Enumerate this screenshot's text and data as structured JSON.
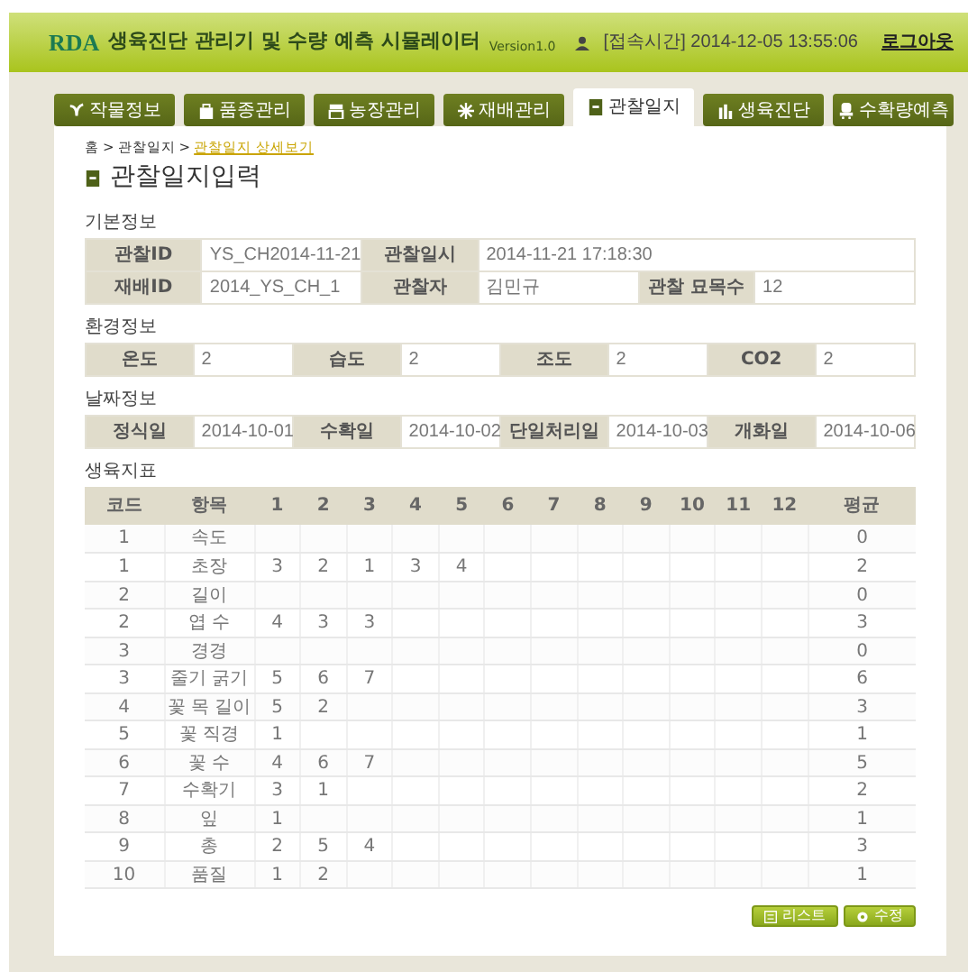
{
  "header": {
    "logo": "RDA",
    "title": "생육진단 관리기 및 수량 예측 시뮬레이터",
    "version": "Version1.0",
    "login_time": "[접속시간] 2014-12-05 13:55:06",
    "logout": "로그아웃"
  },
  "tabs": [
    {
      "label": "작물정보",
      "selected": false
    },
    {
      "label": "품종관리",
      "selected": false
    },
    {
      "label": "농장관리",
      "selected": false
    },
    {
      "label": "재배관리",
      "selected": false
    },
    {
      "label": "관찰일지",
      "selected": true
    },
    {
      "label": "생육진단",
      "selected": false
    },
    {
      "label": "수확량예측",
      "selected": false
    }
  ],
  "breadcrumb": {
    "separator": ">",
    "items": [
      "홈",
      "관찰일지",
      "관찰일지 상세보기"
    ]
  },
  "page_title": "관찰일지입력",
  "sections": [
    {
      "title": "기본정보",
      "rows": [
        [
          {
            "label": "관찰ID",
            "value": "YS_CH2014-11-21"
          },
          {
            "label": "관찰일시",
            "value": "2014-11-21 17:18:30"
          }
        ],
        [
          {
            "label": "재배ID",
            "value": "2014_YS_CH_1"
          },
          {
            "label": "관찰자",
            "value": "김민규"
          },
          {
            "label": "관찰 묘목수",
            "value": "12"
          }
        ]
      ]
    },
    {
      "title": "환경정보",
      "rows": [
        [
          {
            "label": "온도",
            "value": "2"
          },
          {
            "label": "습도",
            "value": "2"
          },
          {
            "label": "조도",
            "value": "2"
          },
          {
            "label": "CO2",
            "value": "2"
          }
        ]
      ]
    },
    {
      "title": "날짜정보",
      "rows": [
        [
          {
            "label": "정식일",
            "value": "2014-10-01"
          },
          {
            "label": "수확일",
            "value": "2014-10-02"
          },
          {
            "label": "단일처리일",
            "value": "2014-10-03"
          },
          {
            "label": "개화일",
            "value": "2014-10-06"
          }
        ]
      ]
    }
  ],
  "growth_table": {
    "title": "생육지표",
    "columns": [
      "코드",
      "항목",
      "1",
      "2",
      "3",
      "4",
      "5",
      "6",
      "7",
      "8",
      "9",
      "10",
      "11",
      "12",
      "평균"
    ],
    "rows": [
      {
        "code": "1",
        "item": "속도",
        "values": [],
        "average": "0"
      },
      {
        "code": "1",
        "item": "초장",
        "values": [
          "3",
          "2",
          "1",
          "3",
          "4"
        ],
        "average": "2"
      },
      {
        "code": "2",
        "item": "길이",
        "values": [],
        "average": "0"
      },
      {
        "code": "2",
        "item": "엽 수",
        "values": [
          "4",
          "3",
          "3"
        ],
        "average": "3"
      },
      {
        "code": "3",
        "item": "경경",
        "values": [],
        "average": "0"
      },
      {
        "code": "3",
        "item": "줄기 굵기",
        "values": [
          "5",
          "6",
          "7"
        ],
        "average": "6"
      },
      {
        "code": "4",
        "item": "꽃 목 길이",
        "values": [
          "5",
          "2"
        ],
        "average": "3"
      },
      {
        "code": "5",
        "item": "꽃 직경",
        "values": [
          "1"
        ],
        "average": "1"
      },
      {
        "code": "6",
        "item": "꽃 수",
        "values": [
          "4",
          "6",
          "7"
        ],
        "average": "5"
      },
      {
        "code": "7",
        "item": "수확기",
        "values": [
          "3",
          "1"
        ],
        "average": "2"
      },
      {
        "code": "8",
        "item": "잎",
        "values": [
          "1"
        ],
        "average": "1"
      },
      {
        "code": "9",
        "item": "총",
        "values": [
          "2",
          "5",
          "4"
        ],
        "average": "3"
      },
      {
        "code": "10",
        "item": "품질",
        "values": [
          "1",
          "2"
        ],
        "average": "1"
      }
    ]
  },
  "buttons": [
    {
      "label": "리스트",
      "kind": "list"
    },
    {
      "label": "수정",
      "kind": "edit"
    }
  ]
}
